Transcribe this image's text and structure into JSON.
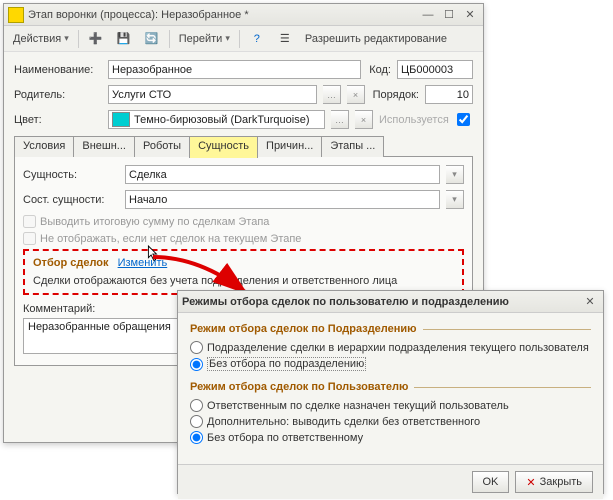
{
  "window": {
    "title": "Этап воронки (процесса): Неразобранное *"
  },
  "toolbar": {
    "actions": "Действия",
    "goto": "Перейти",
    "allow_edit": "Разрешить редактирование"
  },
  "fields": {
    "name_label": "Наименование:",
    "name_value": "Неразобранное",
    "code_label": "Код:",
    "code_value": "ЦБ000003",
    "parent_label": "Родитель:",
    "parent_value": "Услуги СТО",
    "order_label": "Порядок:",
    "order_value": "10",
    "color_label": "Цвет:",
    "color_value": "Темно-бирюзовый (DarkTurquoise)",
    "used_label": "Используется"
  },
  "tabs": [
    "Условия",
    "Внешн...",
    "Роботы",
    "Сущность",
    "Причин...",
    "Этапы ..."
  ],
  "active_tab": 3,
  "entity": {
    "entity_label": "Сущность:",
    "entity_value": "Сделка",
    "state_label": "Сост. сущности:",
    "state_value": "Начало",
    "chk1": "Выводить итоговую сумму по сделкам Этапа",
    "chk2": "Не отображать, если нет сделок на текущем Этапе",
    "group_title": "Отбор сделок",
    "change_link": "Изменить",
    "desc": "Сделки отображаются без учета подразделения и ответственного лица",
    "comment_label": "Комментарий:",
    "comment_value": "Неразобранные обращения"
  },
  "dialog": {
    "title": "Режимы отбора сделок по пользователю и подразделению",
    "grp1_title": "Режим отбора сделок по Подразделению",
    "grp1_r1": "Подразделение сделки в иерархии подразделения текущего пользователя",
    "grp1_r2": "Без отбора по подразделению",
    "grp2_title": "Режим отбора сделок по Пользователю",
    "grp2_r1": "Ответственным по сделке назначен текущий пользователь",
    "grp2_r2": "Дополнительно: выводить сделки без ответственного",
    "grp2_r3": "Без отбора по ответственному",
    "ok": "OK",
    "close": "Закрыть"
  }
}
